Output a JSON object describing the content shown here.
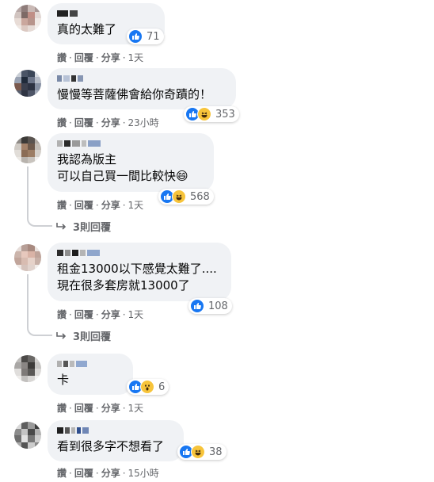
{
  "colors": {
    "like": "#1877f2",
    "haha": "#f7c43b",
    "meta": "#65676b",
    "bubble": "#f0f2f5"
  },
  "actions": {
    "like": "讚",
    "reply": "回覆",
    "share": "分享"
  },
  "comments": [
    {
      "text": [
        "真的太難了"
      ],
      "reactions": [
        "like"
      ],
      "count": "71",
      "time": "1天"
    },
    {
      "text": [
        "慢慢等菩薩佛會給你奇蹟的！"
      ],
      "reactions": [
        "like",
        "haha"
      ],
      "count": "353",
      "time": "23小時"
    },
    {
      "text": [
        "我認為版主",
        "可以自己買一間比較快😄"
      ],
      "reactions": [
        "like",
        "haha"
      ],
      "count": "568",
      "time": "1天",
      "replies": "3則回覆"
    },
    {
      "text": [
        "租金13000以下感覺太難了....",
        "現在很多套房就13000了"
      ],
      "reactions": [
        "like"
      ],
      "count": "108",
      "time": "1天",
      "replies": "3則回覆"
    },
    {
      "text": [
        "卡"
      ],
      "reactions": [
        "like",
        "wow"
      ],
      "count": "6",
      "time": "1天"
    },
    {
      "text": [
        "看到很多字不想看了"
      ],
      "reactions": [
        "like",
        "haha"
      ],
      "count": "38",
      "time": "15小時"
    }
  ]
}
